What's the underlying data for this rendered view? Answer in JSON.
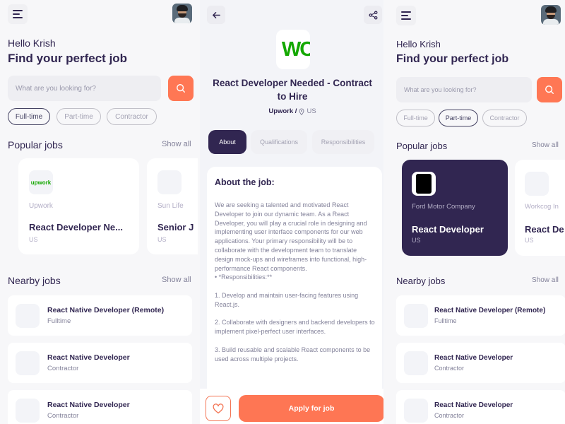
{
  "left": {
    "greeting": "Hello Krish",
    "headline": "Find your perfect job",
    "search_placeholder": "What are you looking for?",
    "chips": [
      "Full-time",
      "Part-time",
      "Contractor"
    ],
    "popular_title": "Popular jobs",
    "show_all": "Show all",
    "popular": [
      {
        "company": "Upwork",
        "logo_text": "upwork",
        "title": "React Developer Ne...",
        "location": "US"
      },
      {
        "company": "Sun Life",
        "title": "Senior J",
        "location": "US"
      }
    ],
    "nearby_title": "Nearby jobs",
    "nearby": [
      {
        "title": "React Native Developer (Remote)",
        "type": "Fulltime"
      },
      {
        "title": "React Native Developer",
        "type": "Contractor"
      },
      {
        "title": "React Native Developer",
        "type": "Contractor"
      }
    ]
  },
  "middle": {
    "logo_text": "WC",
    "job_title": "React Developer Needed - Contract to Hire",
    "company": "Upwork /",
    "location": "US",
    "tabs": [
      "About",
      "Qualifications",
      "Responsibilities"
    ],
    "about_title": "About the job:",
    "about_text": "We are seeking a talented and motivated React Developer to join our dynamic team. As a React Developer, you will play a crucial role in designing and implementing user interface components for our web applications. Your primary responsibility will be to collaborate with the development team to translate design mock-ups and wireframes into functional, high-performance React components.\n• *Responsibilities:**\n\n1. Develop and maintain user-facing features using React.js.\n\n2. Collaborate with designers and backend developers to implement pixel-perfect user interfaces.\n\n3. Build reusable and scalable React components to be used across multiple projects.",
    "apply_label": "Apply for job"
  },
  "right": {
    "greeting": "Hello Krish",
    "headline": "Find your perfect job",
    "search_placeholder": "What are you looking for?",
    "chips": [
      "Full-time",
      "Part-time",
      "Contractor"
    ],
    "popular_title": "Popular jobs",
    "show_all": "Show all",
    "popular": [
      {
        "company": "Ford Motor Company",
        "title": "React Developer",
        "location": "US"
      },
      {
        "company": "Workcog In",
        "title": "React De",
        "location": "US"
      }
    ],
    "nearby_title": "Nearby jobs",
    "nearby": [
      {
        "title": "React Native Developer (Remote)",
        "type": "Fulltime"
      },
      {
        "title": "React Native Developer",
        "type": "Contractor"
      },
      {
        "title": "React Native Developer",
        "type": "Contractor"
      }
    ]
  },
  "colors": {
    "primary": "#312651",
    "accent": "#FF7754",
    "gray": "#83829A",
    "upwork_green": "#14A800",
    "background": "#F7F7F9"
  },
  "icons": [
    "menu-icon",
    "avatar",
    "search-icon",
    "back-arrow-icon",
    "share-icon",
    "location-pin-icon",
    "heart-icon"
  ]
}
